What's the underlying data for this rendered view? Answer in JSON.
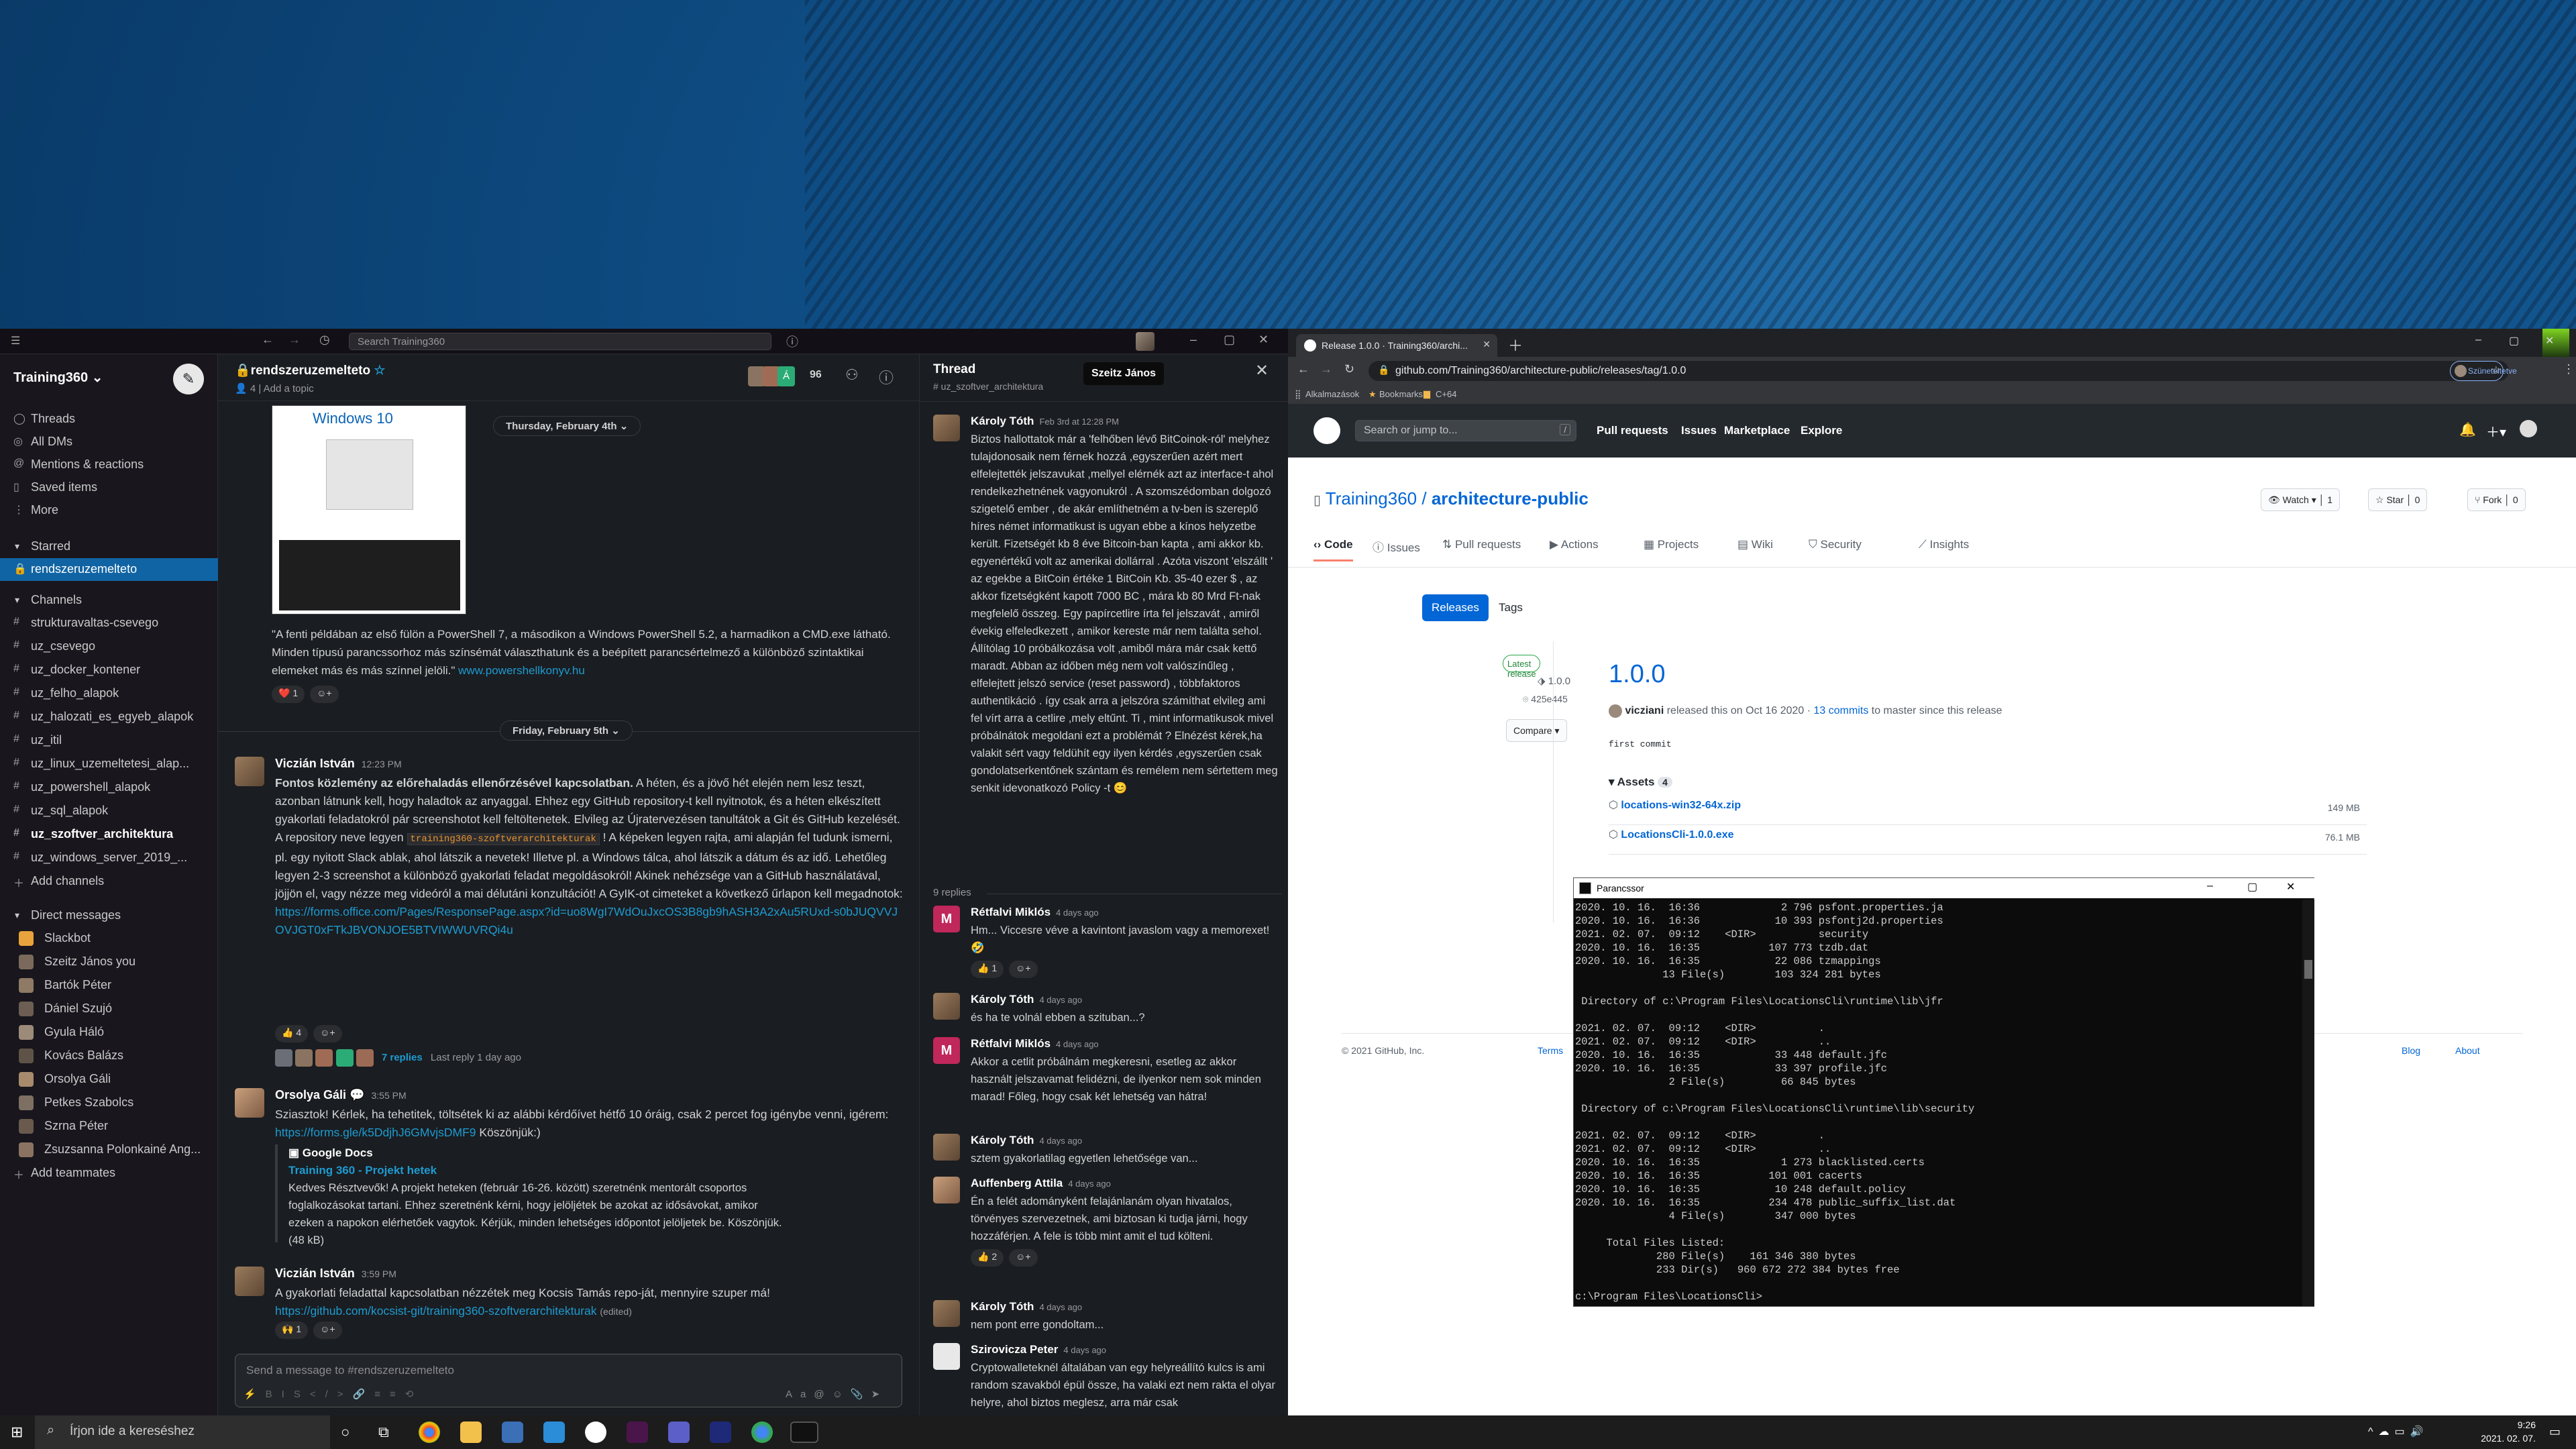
{
  "slack": {
    "search_placeholder": "Search Training360",
    "workspace": "Training360",
    "nav": [
      {
        "label": "Threads",
        "icon": "threads-icon"
      },
      {
        "label": "All DMs",
        "icon": "dm-icon"
      },
      {
        "label": "Mentions & reactions",
        "icon": "at-icon"
      },
      {
        "label": "Saved items",
        "icon": "bookmark-icon"
      },
      {
        "label": "More",
        "icon": "more-icon"
      }
    ],
    "starred_header": "Starred",
    "starred": [
      "rendszeruzemelteto"
    ],
    "channels_header": "Channels",
    "channels": [
      "strukturavaltas-csevego",
      "uz_csevego",
      "uz_docker_kontener",
      "uz_felho_alapok",
      "uz_halozati_es_egyeb_alapok",
      "uz_itil",
      "uz_linux_uzemeltetesi_alap...",
      "uz_powershell_alapok",
      "uz_sql_alapok",
      "uz_szoftver_architektura",
      "uz_windows_server_2019_..."
    ],
    "add_channels": "Add channels",
    "dm_header": "Direct messages",
    "dms": [
      "Slackbot",
      "Szeitz János  you",
      "Bartók Péter",
      "Dániel Szujó",
      "Gyula Háló",
      "Kovács Balázs",
      "Orsolya Gáli",
      "Petkes Szabolcs",
      "Szrna Péter",
      "Zsuzsanna Polonkainé Ang..."
    ],
    "add_teammates": "Add teammates",
    "channel": {
      "name": "rendszeruzemelteto",
      "members": "4",
      "topic": "Add a topic",
      "member_count": "96"
    },
    "date1": "Thursday, February 4th",
    "win_caption": "Windows 10",
    "img_caption": "\"A fenti példában az első fülön a PowerShell 7, a másodikon a Windows PowerShell 5.2, a harmadikon a CMD.exe látható. Minden típusú parancssorhoz más színsémát választhatunk és a beépített parancsértelmező a különböző szintaktikai elemeket más és más színnel jelöli.\"",
    "img_link": "www.powershellkonyv.hu",
    "reaction1": "❤️ 1",
    "date2": "Friday, February 5th",
    "msg1": {
      "name": "Viczián István",
      "time": "12:23 PM",
      "bold": "Fontos közlemény az előrehaladás ellenőrzésével kapcsolatban.",
      "text1": " A héten, és a jövő hét elején nem lesz teszt, azonban látnunk kell, hogy haladtok az anyaggal. Ehhez egy GitHub repository-t kell nyitnotok, és a héten elkészített gyakorlati feladatokról pár screenshotot kell feltöltenetek. Elvileg az Újratervezésen tanultátok a Git és GitHub kezelését. A repository neve legyen ",
      "code": "training360-szoftverarchitekturak",
      "text2": " ! A képeken legyen rajta, ami alapján fel tudunk ismerni, pl. egy nyitott Slack ablak, ahol látszik a nevetek! Illetve pl. a Windows tálca, ahol látszik a dátum és az idő. Lehetőleg legyen 2-3 screenshot a különböző gyakorlati feladat megoldásokról! Akinek nehézsége van a GitHub használatával, jöjjön el, vagy nézze meg videóról a mai délutáni konzultációt! A GyIK-ot cimeteket a következő űrlapon kell megadnotok: ",
      "link": "https://forms.office.com/Pages/ResponsePage.aspx?id=uo8WgI7WdOuJxcOS3B8gb9hASH3A2xAu5RUxd-s0bJUQVVJOVJGT0xFTkJBVONJOE5BTVIWWUVRQi4u",
      "reaction": "👍 4",
      "replies": "7 replies",
      "last_reply": "Last reply 1 day ago"
    },
    "msg2": {
      "name": "Orsolya Gáli",
      "time": "3:55 PM",
      "text": "Sziasztok! Kérlek, ha tehetitek, töltsétek ki az alábbi kérdőívet hétfő 10 óráig, csak 2 percet fog igénybe venni, igérem: ",
      "link": "https://forms.gle/k5DdjhJ6GMvjsDMF9",
      "text2": " Köszönjük:)",
      "unfurl_source": "Google Docs",
      "unfurl_title": "Training 360 - Projekt hetek",
      "unfurl_text": "Kedves Résztvevők! A projekt heteken (február 16-26. között) szeretnénk mentorált csoportos foglalkozásokat tartani. Ehhez szeretnénk kérni, hogy jelöljétek be azokat az idősávokat, amikor ezeken a napokon elérhetőek vagytok. Kérjük, minden lehetséges időpontot jelöljetek be. Köszönjük. (48 kB)"
    },
    "msg3": {
      "name": "Viczián István",
      "time": "3:59 PM",
      "text": "A gyakorlati feladattal kapcsolatban nézzétek meg Kocsis Tamás repo-ját, mennyire szuper má!",
      "link": "https://github.com/kocsist-git/training360-szoftverarchitekturak",
      "edited": "(edited)",
      "reaction": "🙌 1"
    },
    "composer_placeholder": "Send a message to #rendszeruzemelteto",
    "thread": {
      "title": "Thread",
      "channel": "# uz_szoftver_architektura",
      "tooltip": "Szeitz János",
      "main": {
        "name": "Károly Tóth",
        "time": "Feb 3rd at 12:28 PM",
        "text": "Biztos hallottatok már a 'felhőben lévő BitCoinok-ról' melyhez tulajdonosaik nem férnek hozzá ,egyszerűen azért mert elfelejtették jelszavukat ,mellyel elérnék azt az interface-t ahol rendelkezhetnének vagyonukról . A szomszédomban dolgozó szigetelő ember , de akár említhetném a tv-ben is szereplő híres német informatikust is ugyan ebbe a kínos helyzetbe került. Fizetségét kb 8 éve Bitcoin-ban kapta , ami akkor kb. egyenértékű volt az amerikai dollárral . Azóta viszont 'elszállt ' az egekbe a BitCoin értéke 1 BitCoin Kb. 35-40 ezer $ , az akkor fizetségként kapott 7000 BC , mára kb 80 Mrd Ft-nak megfelelő összeg. Egy papírcetlire írta fel jelszavát , amiről évekig elfeledkezett , amikor kereste már nem találta sehol. Állítólag 10 próbálkozása volt ,amiből mára már csak kettő maradt. Abban az időben még nem volt valószínűleg , elfelejtett jelszó service (reset password) , többfaktoros authentikáció . így csak arra a jelszóra számíthat elvileg ami fel vírt arra a cetlire ,mely eltűnt. Ti , mint informatikusok mivel próbálnátok megoldani ezt a problémát ? Elnézést kérek,ha valakit sért vagy feldühít egy ilyen kérdés ,egyszerűen csak gondolatserkentőnek szántam és remélem nem sértettem meg senkit idevonatkozó Policy -t 😊"
      },
      "replies_label": "9 replies",
      "replies": [
        {
          "name": "Rétfalvi Miklós",
          "time": "4 days ago",
          "text": "Hm... Viccesre véve a kavintont javaslom vagy a memorexet! 🤣",
          "reaction": "👍 1",
          "m": "M"
        },
        {
          "name": "Károly Tóth",
          "time": "4 days ago",
          "text": "és ha te volnál ebben a szituban...?",
          "reaction": "",
          "m": ""
        },
        {
          "name": "Rétfalvi Miklós",
          "time": "4 days ago",
          "text": "Akkor a cetlit próbálnám megkeresni, esetleg az akkor használt jelszavamat felidézni, de ilyenkor nem sok minden marad! Főleg, hogy csak két lehetség van hátra!",
          "reaction": "",
          "m": "M"
        },
        {
          "name": "Károly Tóth",
          "time": "4 days ago",
          "text": "sztem gyakorlatilag egyetlen lehetősége van...",
          "reaction": "",
          "m": ""
        },
        {
          "name": "Auffenberg Attila",
          "time": "4 days ago",
          "text": "Én a felét adományként felajánlanám olyan hivatalos, törvényes szervezetnek, ami biztosan ki tudja járni, hogy hozzáférjen. A fele is több mint amit el tud költeni.",
          "reaction": "👍 2",
          "m": ""
        },
        {
          "name": "Károly Tóth",
          "time": "4 days ago",
          "text": "nem pont erre gondoltam...",
          "reaction": "",
          "m": ""
        },
        {
          "name": "Szirovicza Peter",
          "time": "4 days ago",
          "text": "Cryptowalleteknél általában van egy helyreállító kulcs is ami random szavakból épül össze, ha valaki ezt nem rakta el olyan helyre, ahol biztos meglesz, arra már csak",
          "reaction": "",
          "m": ""
        }
      ]
    }
  },
  "chrome": {
    "tab_title": "Release 1.0.0 · Training360/archi...",
    "url": "github.com/Training360/architecture-public/releases/tag/1.0.0",
    "profile": "Szüneteltetve",
    "bookmarks": [
      "Alkalmazások",
      "Bookmarks",
      "C+64"
    ],
    "gh": {
      "search": "Search or jump to...",
      "nav": [
        "Pull requests",
        "Issues",
        "Marketplace",
        "Explore"
      ],
      "owner": "Training360",
      "repo": "architecture-public",
      "watch": "Watch",
      "watch_count": "1",
      "star": "Star",
      "star_count": "0",
      "fork": "Fork",
      "fork_count": "0",
      "tabs": [
        "Code",
        "Issues",
        "Pull requests",
        "Actions",
        "Projects",
        "Wiki",
        "Security",
        "Insights"
      ],
      "releases_btn": "Releases",
      "tags_btn": "Tags",
      "latest": "Latest release",
      "tag": "1.0.0",
      "commit": "425e445",
      "compare": "Compare",
      "release_title": "1.0.0",
      "release_meta_user": "vicziani",
      "release_meta_text": "released this on Oct 16 2020 · ",
      "release_meta_commits": "13 commits",
      "release_meta_end": " to master since this release",
      "body": "first commit",
      "assets": "Assets",
      "assets_count": "4",
      "asset_list": [
        {
          "name": "locations-win32-64x.zip",
          "size": "149 MB"
        },
        {
          "name": "LocationsCli-1.0.0.exe",
          "size": "76.1 MB"
        }
      ],
      "footer": [
        "© 2021 GitHub, Inc.",
        "Terms",
        "Blog",
        "About"
      ]
    }
  },
  "cmd": {
    "title": "Parancssor",
    "lines": [
      "2020. 10. 16.  16:36             2 796 psfont.properties.ja",
      "2020. 10. 16.  16:36            10 393 psfontj2d.properties",
      "2021. 02. 07.  09:12    <DIR>          security",
      "2020. 10. 16.  16:35           107 773 tzdb.dat",
      "2020. 10. 16.  16:35            22 086 tzmappings",
      "              13 File(s)        103 324 281 bytes",
      "",
      " Directory of c:\\Program Files\\LocationsCli\\runtime\\lib\\jfr",
      "",
      "2021. 02. 07.  09:12    <DIR>          .",
      "2021. 02. 07.  09:12    <DIR>          ..",
      "2020. 10. 16.  16:35            33 448 default.jfc",
      "2020. 10. 16.  16:35            33 397 profile.jfc",
      "               2 File(s)         66 845 bytes",
      "",
      " Directory of c:\\Program Files\\LocationsCli\\runtime\\lib\\security",
      "",
      "2021. 02. 07.  09:12    <DIR>          .",
      "2021. 02. 07.  09:12    <DIR>          ..",
      "2020. 10. 16.  16:35             1 273 blacklisted.certs",
      "2020. 10. 16.  16:35           101 001 cacerts",
      "2020. 10. 16.  16:35            10 248 default.policy",
      "2020. 10. 16.  16:35           234 478 public_suffix_list.dat",
      "               4 File(s)        347 000 bytes",
      "",
      "     Total Files Listed:",
      "             280 File(s)    161 346 380 bytes",
      "             233 Dir(s)   960 672 272 384 bytes free",
      "",
      "c:\\Program Files\\LocationsCli>"
    ]
  },
  "taskbar": {
    "search": "Írjon ide a kereséshez",
    "time": "9:26",
    "date": "2021. 02. 07."
  }
}
